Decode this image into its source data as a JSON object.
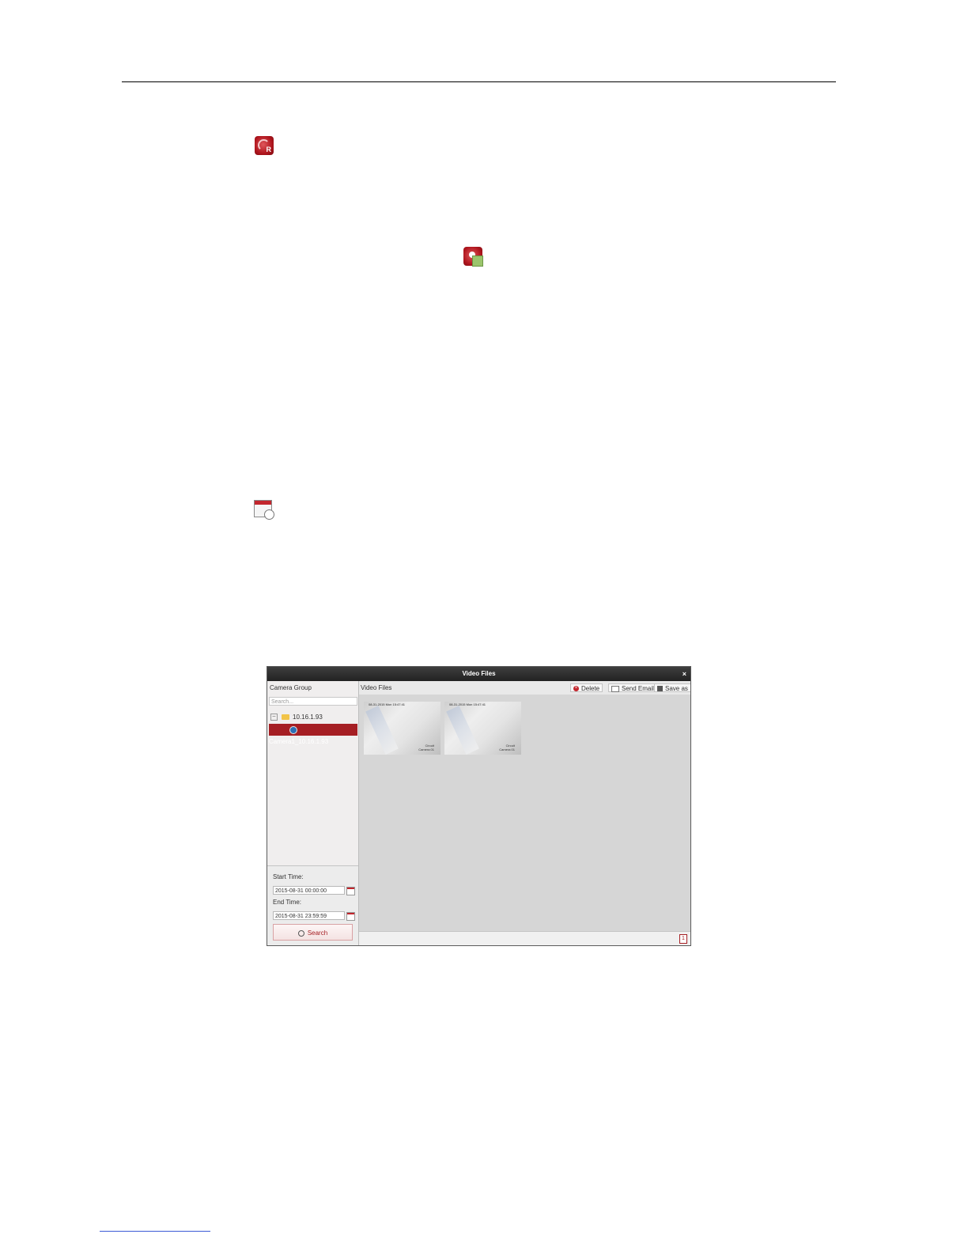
{
  "doc_icons": {
    "record": "record-icon",
    "play_record": "play-record-icon",
    "calendar": "calendar-clock-icon"
  },
  "window": {
    "title": "Video Files",
    "close_label": "×",
    "left": {
      "header": "Camera Group",
      "search_placeholder": "Search...",
      "tree": {
        "root_label": "10.16.1.93",
        "root_expander": "–",
        "child_label": "Camera1_10.16.1.93"
      },
      "start_label": "Start Time:",
      "start_value": "2015-08-31 00:00:00",
      "end_label": "End Time:",
      "end_value": "2015-08-31 23:59:59",
      "search_button": "Search"
    },
    "right": {
      "header": "Video Files",
      "delete": "Delete",
      "send_email": "Send Email",
      "save_as": "Save as",
      "thumbnails": [
        {
          "stamp": "08-31-2015 Mon 15:47:41",
          "caption_line1": "Circuit",
          "caption_line2": "Camera 01"
        },
        {
          "stamp": "08-31-2015 Mon 15:47:41",
          "caption_line1": "Circuit",
          "caption_line2": "Camera 01"
        }
      ],
      "page": "1"
    }
  },
  "colors": {
    "accent": "#a51e23",
    "titlebar": "#2e2e2e"
  }
}
